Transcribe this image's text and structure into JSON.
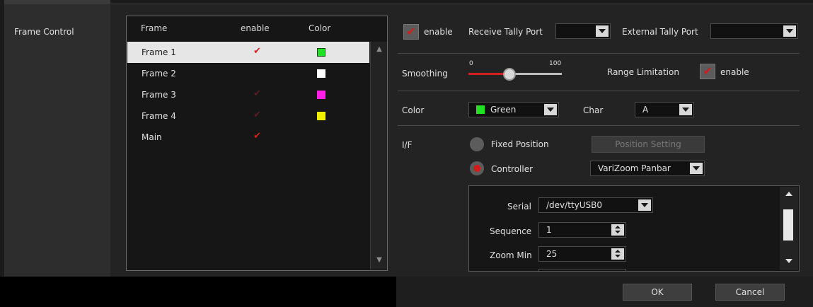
{
  "sidebar": {
    "label": "Frame Control"
  },
  "table": {
    "headers": {
      "frame": "Frame",
      "enable": "enable",
      "color": "Color"
    },
    "rows": [
      {
        "name": "Frame 1",
        "enabled": true,
        "check": "✔",
        "color": "green",
        "selected": true
      },
      {
        "name": "Frame 2",
        "enabled": false,
        "check": "",
        "color": "white",
        "selected": false
      },
      {
        "name": "Frame 3",
        "enabled": false,
        "check": "✔",
        "color": "magenta",
        "selected": false
      },
      {
        "name": "Frame 4",
        "enabled": false,
        "check": "✔",
        "color": "yellow",
        "selected": false
      },
      {
        "name": "Main",
        "enabled": true,
        "check": "✔",
        "color": "",
        "selected": false
      }
    ]
  },
  "tally": {
    "enable_label": "enable",
    "enable_checked": true,
    "receive_port_label": "Receive Tally Port",
    "receive_port_value": "",
    "external_port_label": "External Tally Port",
    "external_port_value": ""
  },
  "smoothing": {
    "label": "Smoothing",
    "min": "0",
    "max": "100",
    "value": 40
  },
  "range_limitation": {
    "label": "Range Limitation",
    "enable_label": "enable",
    "enable_checked": true
  },
  "color": {
    "label": "Color",
    "value": "Green",
    "swatch": "#22e022"
  },
  "char": {
    "label": "Char",
    "value": "A"
  },
  "interface": {
    "label": "I/F",
    "fixed_position_label": "Fixed Position",
    "fixed_position_selected": false,
    "position_setting_label": "Position Setting",
    "controller_label": "Controller",
    "controller_selected": true,
    "controller_value": "VariZoom Panbar"
  },
  "controller_settings": {
    "serial_label": "Serial",
    "serial_value": "/dev/ttyUSB0",
    "sequence_label": "Sequence",
    "sequence_value": "1",
    "zoom_min_label": "Zoom Min",
    "zoom_min_value": "25"
  },
  "footer": {
    "ok_label": "OK",
    "cancel_label": "Cancel"
  },
  "colors": {
    "accent_red": "#d41b1b",
    "selection": "#e6e6e6"
  }
}
